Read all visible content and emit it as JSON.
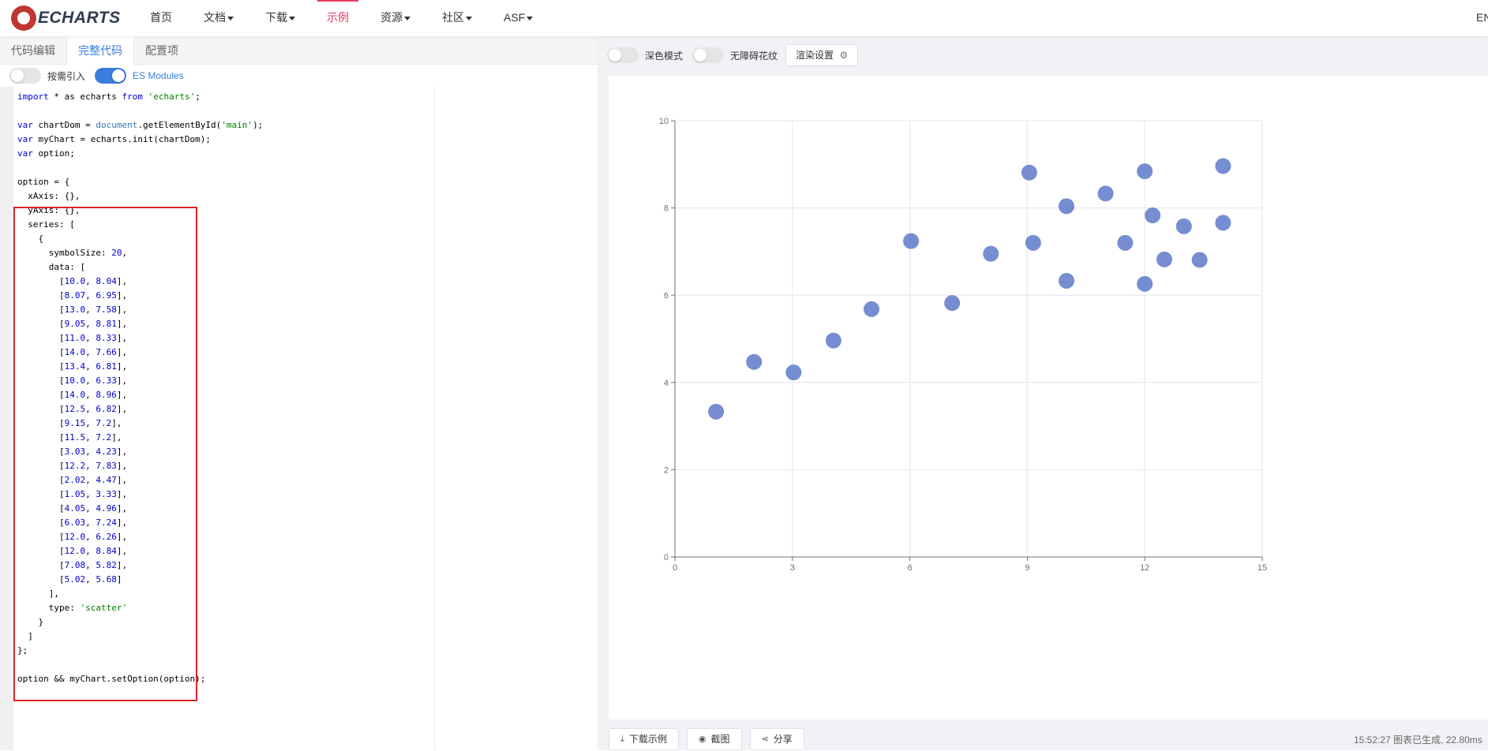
{
  "nav": {
    "logo_text": "ECHARTS",
    "items": [
      {
        "label": "首页",
        "dropdown": false,
        "active": false
      },
      {
        "label": "文档",
        "dropdown": true,
        "active": false
      },
      {
        "label": "下载",
        "dropdown": true,
        "active": false
      },
      {
        "label": "示例",
        "dropdown": false,
        "active": true
      },
      {
        "label": "资源",
        "dropdown": true,
        "active": false
      },
      {
        "label": "社区",
        "dropdown": true,
        "active": false
      },
      {
        "label": "ASF",
        "dropdown": true,
        "active": false
      }
    ],
    "lang": "EN"
  },
  "left": {
    "tabs": [
      "代码编辑",
      "完整代码",
      "配置项"
    ],
    "active_tab": 1,
    "toggle_import": {
      "label": "按需引入",
      "on": false
    },
    "toggle_es": {
      "label": "ES Modules",
      "on": true
    }
  },
  "code_lines": [
    "import * as echarts from 'echarts';",
    "",
    "var chartDom = document.getElementById('main');",
    "var myChart = echarts.init(chartDom);",
    "var option;",
    "",
    "option = {",
    "  xAxis: {},",
    "  yAxis: {},",
    "  series: [",
    "    {",
    "      symbolSize: 20,",
    "      data: [",
    "        [10.0, 8.04],",
    "        [8.07, 6.95],",
    "        [13.0, 7.58],",
    "        [9.05, 8.81],",
    "        [11.0, 8.33],",
    "        [14.0, 7.66],",
    "        [13.4, 6.81],",
    "        [10.0, 6.33],",
    "        [14.0, 8.96],",
    "        [12.5, 6.82],",
    "        [9.15, 7.2],",
    "        [11.5, 7.2],",
    "        [3.03, 4.23],",
    "        [12.2, 7.83],",
    "        [2.02, 4.47],",
    "        [1.05, 3.33],",
    "        [4.05, 4.96],",
    "        [6.03, 7.24],",
    "        [12.0, 6.26],",
    "        [12.0, 8.84],",
    "        [7.08, 5.82],",
    "        [5.02, 5.68]",
    "      ],",
    "      type: 'scatter'",
    "    }",
    "  ]",
    "};",
    "",
    "option && myChart.setOption(option);"
  ],
  "right": {
    "dark_mode_label": "深色模式",
    "aria_label": "无障碍花纹",
    "render_label": "渲染设置",
    "download_label": "下载示例",
    "screenshot_label": "截图",
    "share_label": "分享",
    "status": "15:52:27   图表已生成, 22.80ms"
  },
  "colors": {
    "accent": "#e43961",
    "blue": "#3b7ddd",
    "point": "#5470c6",
    "highlight": "#d9252b"
  },
  "chart_data": {
    "type": "scatter",
    "title": "",
    "xlabel": "",
    "ylabel": "",
    "xlim": [
      0,
      15
    ],
    "ylim": [
      0,
      10
    ],
    "xticks": [
      0,
      3,
      6,
      9,
      12,
      15
    ],
    "yticks": [
      0,
      2,
      4,
      6,
      8,
      10
    ],
    "grid": true,
    "symbol_size": 20,
    "series": [
      {
        "points": [
          [
            10.0,
            8.04
          ],
          [
            8.07,
            6.95
          ],
          [
            13.0,
            7.58
          ],
          [
            9.05,
            8.81
          ],
          [
            11.0,
            8.33
          ],
          [
            14.0,
            7.66
          ],
          [
            13.4,
            6.81
          ],
          [
            10.0,
            6.33
          ],
          [
            14.0,
            8.96
          ],
          [
            12.5,
            6.82
          ],
          [
            9.15,
            7.2
          ],
          [
            11.5,
            7.2
          ],
          [
            3.03,
            4.23
          ],
          [
            12.2,
            7.83
          ],
          [
            2.02,
            4.47
          ],
          [
            1.05,
            3.33
          ],
          [
            4.05,
            4.96
          ],
          [
            6.03,
            7.24
          ],
          [
            12.0,
            6.26
          ],
          [
            12.0,
            8.84
          ],
          [
            7.08,
            5.82
          ],
          [
            5.02,
            5.68
          ]
        ]
      }
    ]
  }
}
